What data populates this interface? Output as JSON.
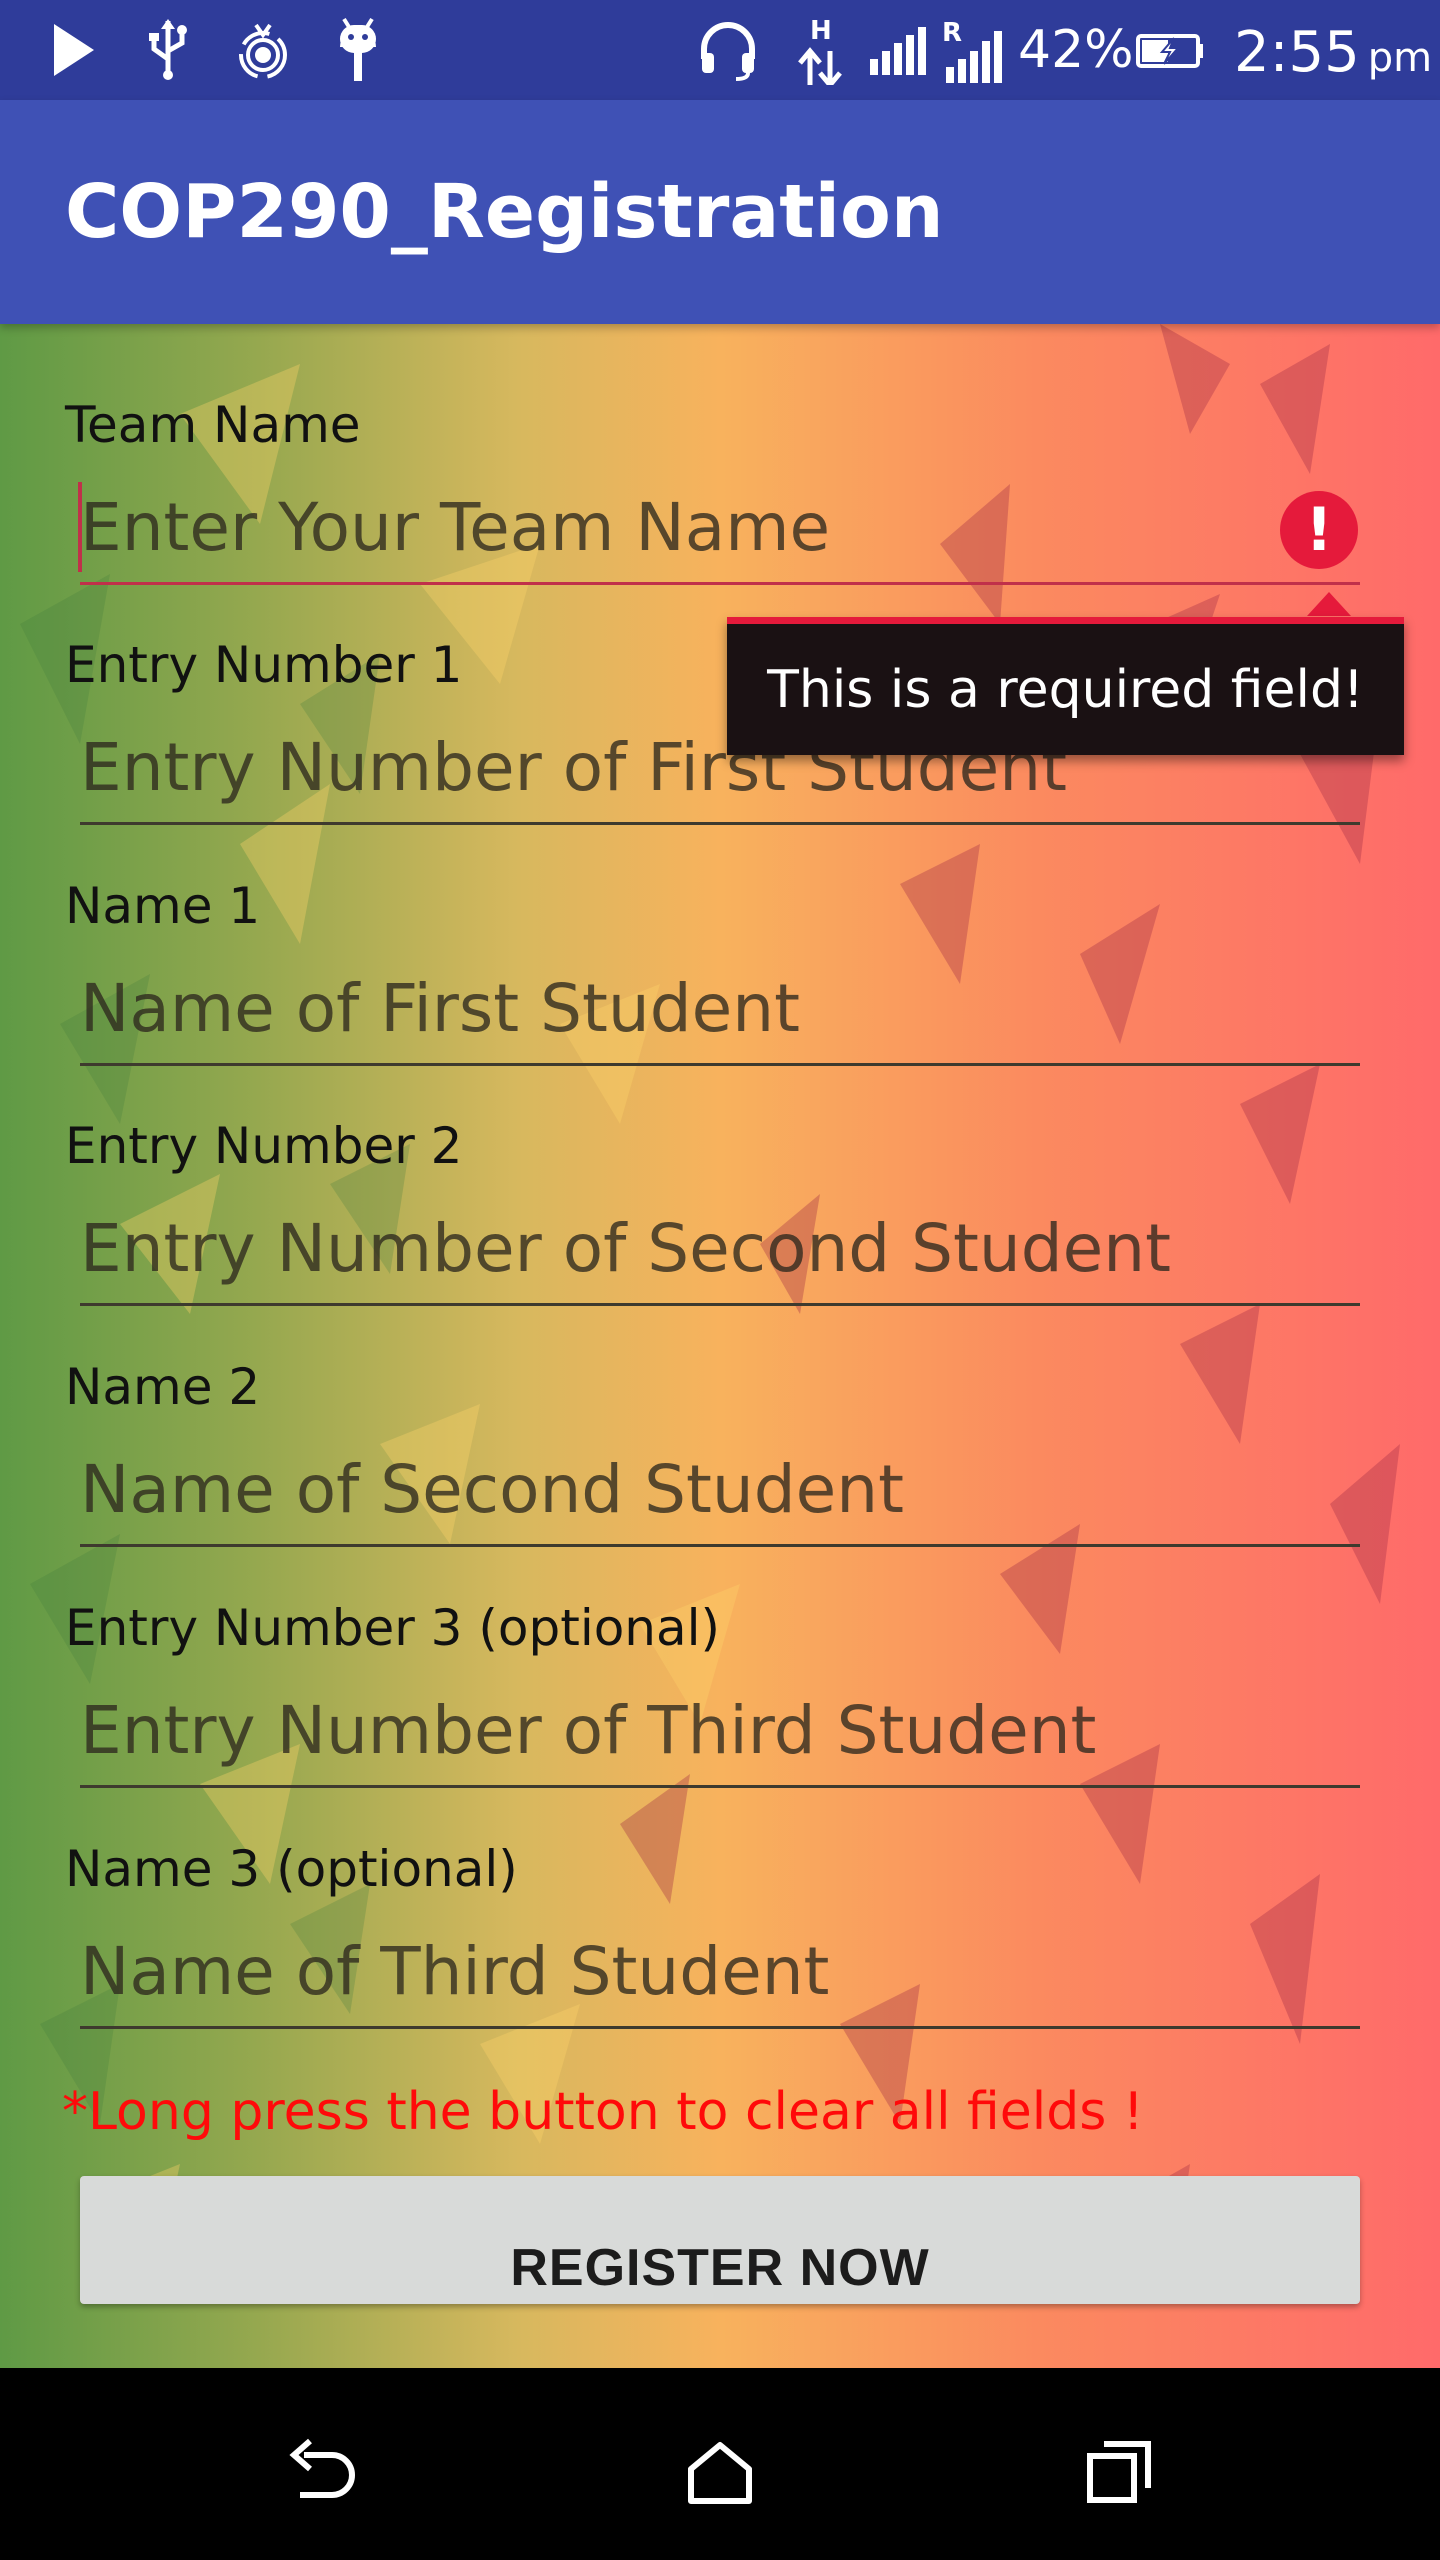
{
  "status_bar": {
    "battery": "42%",
    "time": "2:55",
    "ampm": "pm",
    "network_type": "H",
    "roaming": "R",
    "icons": [
      "play-store-icon",
      "usb-icon",
      "hotspot-icon",
      "android-icon",
      "headset-icon",
      "data-arrows-icon",
      "signal-icon",
      "signal-roaming-icon",
      "battery-charging-icon"
    ]
  },
  "app_bar": {
    "title": "COP290_Registration"
  },
  "form": {
    "team_name": {
      "label": "Team Name",
      "placeholder": "Enter Your Team Name"
    },
    "entry1": {
      "label": "Entry Number 1",
      "placeholder": "Entry Number of First Student"
    },
    "name1": {
      "label": "Name 1",
      "placeholder": "Name of First Student"
    },
    "entry2": {
      "label": "Entry Number 2",
      "placeholder": "Entry Number of Second Student"
    },
    "name2": {
      "label": "Name 2",
      "placeholder": "Name of Second Student"
    },
    "entry3": {
      "label": "Entry Number 3 (optional)",
      "placeholder": "Entry Number of Third Student"
    },
    "name3": {
      "label": "Name 3 (optional)",
      "placeholder": "Name of Third Student"
    }
  },
  "error": {
    "icon": "!",
    "tooltip": "This is a required field!"
  },
  "hint": "*Long press the button to clear all fields !",
  "register_button": "REGISTER NOW",
  "nav_bar": {
    "icons": [
      "back-icon",
      "home-icon",
      "recents-icon"
    ]
  },
  "colors": {
    "status_bar": "#2f3c9a",
    "app_bar": "#3f51b5",
    "error": "#e51a3b",
    "hint": "#ff0a0a",
    "button": "#d8dad9"
  }
}
